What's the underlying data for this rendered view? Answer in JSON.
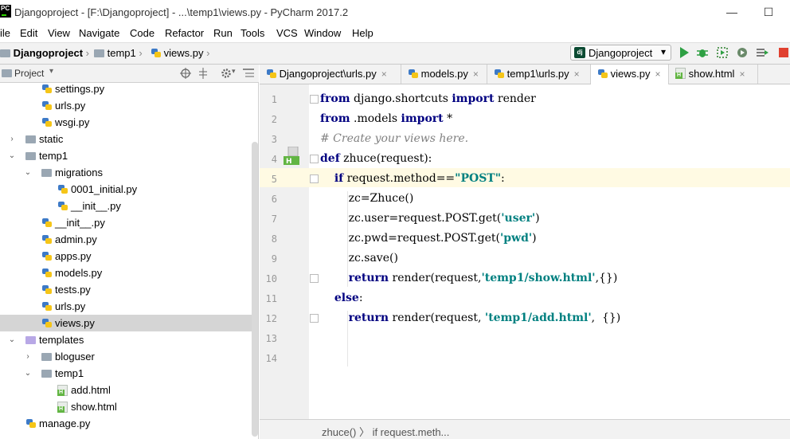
{
  "window": {
    "title": "Djangoproject - [F:\\Djangoproject] - ...\\temp1\\views.py - PyCharm 2017.2",
    "app_logo": "PC",
    "minimize": "—",
    "maximize": "☐"
  },
  "menu": [
    "ile",
    "Edit",
    "View",
    "Navigate",
    "Code",
    "Refactor",
    "Run",
    "Tools",
    "VCS",
    "Window",
    "Help"
  ],
  "breadcrumbs": [
    "Djangoproject",
    "temp1",
    "views.py"
  ],
  "run_config": {
    "label": "Djangoproject",
    "icon": "dj",
    "arrow": "▾"
  },
  "toolbar_colors": {
    "run": "#2ea043",
    "stop": "#e0402f"
  },
  "project_panel": {
    "title": "Project",
    "tree": [
      {
        "label": "settings.py",
        "type": "py",
        "depth": 2
      },
      {
        "label": "urls.py",
        "type": "py",
        "depth": 2
      },
      {
        "label": "wsgi.py",
        "type": "py",
        "depth": 2
      },
      {
        "label": "static",
        "type": "folder",
        "depth": 1,
        "arrow": "›"
      },
      {
        "label": "temp1",
        "type": "folder",
        "depth": 1,
        "arrow": "⌄"
      },
      {
        "label": "migrations",
        "type": "folder",
        "depth": 2,
        "arrow": "⌄"
      },
      {
        "label": "0001_initial.py",
        "type": "py",
        "depth": 3
      },
      {
        "label": "__init__.py",
        "type": "py",
        "depth": 3
      },
      {
        "label": "__init__.py",
        "type": "py",
        "depth": 2
      },
      {
        "label": "admin.py",
        "type": "py",
        "depth": 2
      },
      {
        "label": "apps.py",
        "type": "py",
        "depth": 2
      },
      {
        "label": "models.py",
        "type": "py",
        "depth": 2
      },
      {
        "label": "tests.py",
        "type": "py",
        "depth": 2
      },
      {
        "label": "urls.py",
        "type": "py",
        "depth": 2
      },
      {
        "label": "views.py",
        "type": "py",
        "depth": 2,
        "selected": true
      },
      {
        "label": "templates",
        "type": "folder-purple",
        "depth": 1,
        "arrow": "⌄"
      },
      {
        "label": "bloguser",
        "type": "folder",
        "depth": 2,
        "arrow": "›"
      },
      {
        "label": "temp1",
        "type": "folder",
        "depth": 2,
        "arrow": "⌄"
      },
      {
        "label": "add.html",
        "type": "html",
        "depth": 3
      },
      {
        "label": "show.html",
        "type": "html",
        "depth": 3
      },
      {
        "label": "manage.py",
        "type": "py",
        "depth": 1
      }
    ]
  },
  "tabs": [
    {
      "label": "Djangoproject\\urls.py",
      "type": "py"
    },
    {
      "label": "models.py",
      "type": "py"
    },
    {
      "label": "temp1\\urls.py",
      "type": "py"
    },
    {
      "label": "views.py",
      "type": "py",
      "active": true
    },
    {
      "label": "show.html",
      "type": "html"
    }
  ],
  "tab_close": "×",
  "editor": {
    "line_numbers": [
      "1",
      "2",
      "3",
      "4",
      "5",
      "6",
      "7",
      "8",
      "9",
      "10",
      "11",
      "12",
      "13",
      "14"
    ],
    "current_line": 5,
    "lines": [
      [
        {
          "t": "from",
          "c": "kw"
        },
        {
          "t": " django.shortcuts "
        },
        {
          "t": "import",
          "c": "kw"
        },
        {
          "t": " render"
        }
      ],
      [
        {
          "t": "from",
          "c": "kw"
        },
        {
          "t": " .models "
        },
        {
          "t": "import",
          "c": "kw"
        },
        {
          "t": " *"
        }
      ],
      [
        {
          "t": "# Create your views here.",
          "c": "cmt"
        }
      ],
      [
        {
          "t": "def",
          "c": "kw"
        },
        {
          "t": " zhuce(request):"
        }
      ],
      [
        {
          "t": "    "
        },
        {
          "t": "if",
          "c": "kw"
        },
        {
          "t": " request.method=="
        },
        {
          "t": "\"POST\"",
          "c": "str"
        },
        {
          "t": ":"
        }
      ],
      [
        {
          "t": "        zc=Zhuce()"
        }
      ],
      [
        {
          "t": "        zc.user=request.POST.get("
        },
        {
          "t": "'user'",
          "c": "str"
        },
        {
          "t": ")"
        }
      ],
      [
        {
          "t": "        zc.pwd=request.POST.get("
        },
        {
          "t": "'pwd'",
          "c": "str"
        },
        {
          "t": ")"
        }
      ],
      [
        {
          "t": "        zc.save()"
        }
      ],
      [
        {
          "t": "        "
        },
        {
          "t": "return",
          "c": "kw"
        },
        {
          "t": " render(request,"
        },
        {
          "t": "'temp1/show.html'",
          "c": "str"
        },
        {
          "t": ",{})"
        }
      ],
      [
        {
          "t": "    "
        },
        {
          "t": "else",
          "c": "kw"
        },
        {
          "t": ":"
        }
      ],
      [
        {
          "t": "        "
        },
        {
          "t": "return",
          "c": "kw"
        },
        {
          "t": " render(request, "
        },
        {
          "t": "'temp1/add.html'",
          "c": "str"
        },
        {
          "t": ",  {})"
        }
      ],
      [],
      []
    ]
  },
  "statusbar": {
    "breadcrumb": "zhuce()   〉  if request.meth..."
  }
}
